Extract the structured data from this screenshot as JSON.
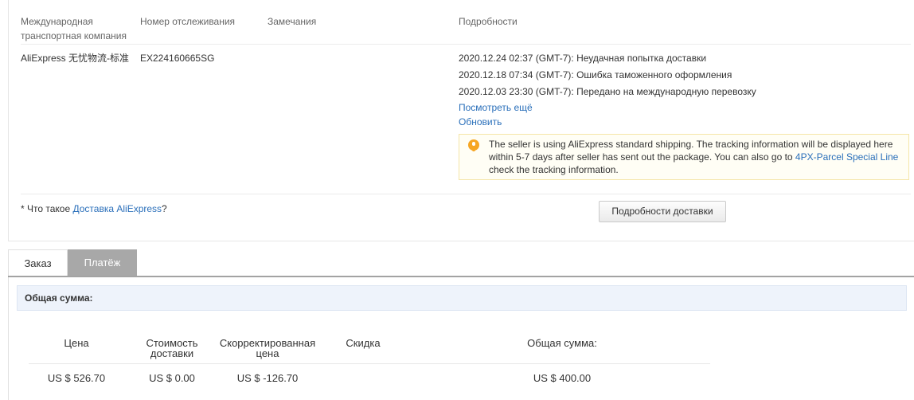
{
  "tracking": {
    "headers": {
      "carrier": "Международная транспортная компания",
      "tracking_number": "Номер отслеживания",
      "notes": "Замечания",
      "details": "Подробности"
    },
    "carrier": "AliExpress 无忧物流-标准",
    "tracking_number": "EX224160665SG",
    "events": [
      "2020.12.24 02:37 (GMT-7): Неудачная попытка доставки",
      "2020.12.18 07:34 (GMT-7): Ошибка таможенного оформления",
      "2020.12.03 23:30 (GMT-7): Передано на международную перевозку"
    ],
    "view_more": "Посмотреть ещё",
    "refresh": "Обновить",
    "notice": {
      "text_before": "The seller is using AliExpress standard shipping. The tracking information will be displayed here within 5-7 days after seller has sent out the package. You can also go to ",
      "link": "4PX-Parcel Special Line",
      "text_after": " check the tracking information."
    },
    "what_is_prefix": "* Что такое ",
    "what_is_link": "Доставка AliExpress",
    "what_is_suffix": "?",
    "delivery_details_button": "Подробности доставки"
  },
  "tabs": [
    {
      "label": "Заказ",
      "active": false
    },
    {
      "label": "Платёж",
      "active": true
    }
  ],
  "totals": {
    "title": "Общая сумма:",
    "columns": [
      "Цена",
      "Стоимость доставки",
      "Скорректированная цена",
      "Скидка",
      "Общая сумма:"
    ],
    "values": [
      "US $ 526.70",
      "US $ 0.00",
      "US $ -126.70",
      "",
      "US $ 400.00"
    ]
  },
  "colors": {
    "link": "#2a6fba",
    "active_tab": "#a8a8a8",
    "notice_icon": "#f6a623",
    "totals_header_bg": "#eef3fb"
  }
}
